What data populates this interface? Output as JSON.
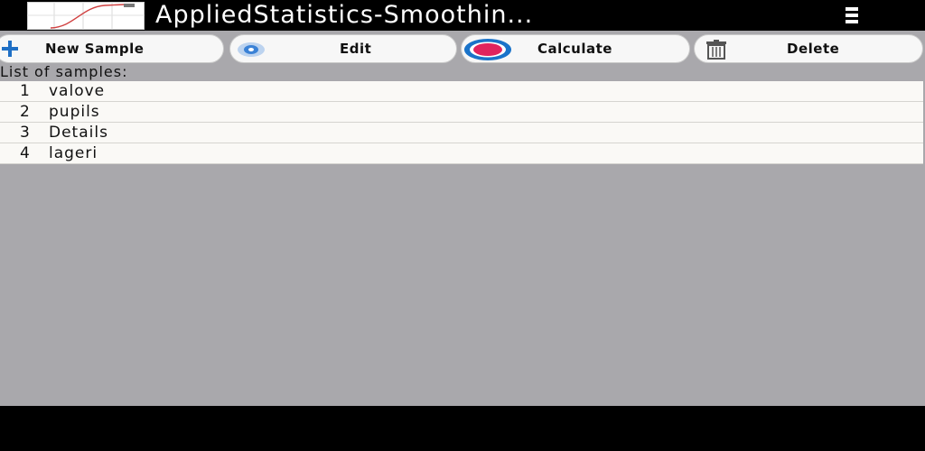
{
  "app": {
    "title": "AppliedStatistics-Smoothin..."
  },
  "toolbar": {
    "new_sample_label": "New Sample",
    "edit_label": "Edit",
    "calculate_label": "Calculate",
    "delete_label": "Delete"
  },
  "samples": {
    "caption": "List of samples:",
    "items": [
      {
        "num": "1",
        "name": "valove"
      },
      {
        "num": "2",
        "name": "pupils"
      },
      {
        "num": "3",
        "name": "Details"
      },
      {
        "num": "4",
        "name": "lageri"
      }
    ]
  },
  "icons": {
    "app": "sigmoid-curve-icon",
    "menu": "overflow-menu-icon",
    "new": "plus-icon",
    "edit": "edit-icon",
    "calculate": "target-icon",
    "delete": "trash-icon"
  },
  "colors": {
    "titlebar": "#000000",
    "background": "#a9a8ac",
    "row": "#faf9f6",
    "plus": "#1f6fc5",
    "target_outer": "#1a73c9",
    "target_inner": "#e0245e",
    "curve": "#d04040"
  }
}
